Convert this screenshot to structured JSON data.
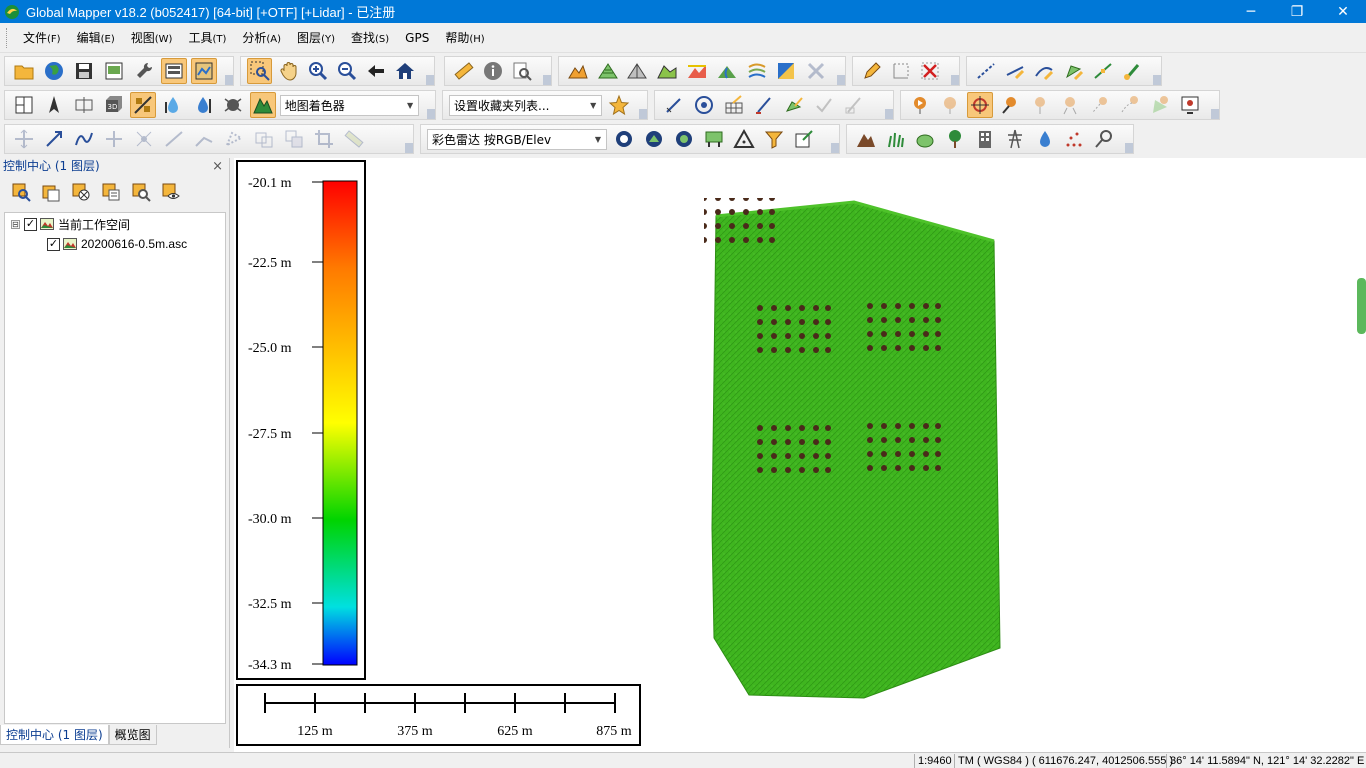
{
  "window": {
    "title": "Global Mapper v18.2 (b052417) [64-bit] [+OTF] [+Lidar] - 已注册",
    "minimize": "─",
    "restore": "❐",
    "close": "✕"
  },
  "menu": [
    {
      "label": "文件",
      "acc": "(F)"
    },
    {
      "label": "编辑",
      "acc": "(E)"
    },
    {
      "label": "视图",
      "acc": "(W)"
    },
    {
      "label": "工具",
      "acc": "(T)"
    },
    {
      "label": "分析",
      "acc": "(A)"
    },
    {
      "label": "图层",
      "acc": "(Y)"
    },
    {
      "label": "查找",
      "acc": "(S)"
    },
    {
      "label": "GPS",
      "acc": ""
    },
    {
      "label": "帮助",
      "acc": "(H)"
    }
  ],
  "toolbar": {
    "shader_select": "地图着色器",
    "favorites_select": "设置收藏夹列表...",
    "lidar_color_select": "彩色雷达 按RGB/Elev"
  },
  "control_center": {
    "title": "控制中心 (1 图层)",
    "close": "×",
    "tree": {
      "workspace_label": "当前工作空间",
      "layer_label": "20200616-0.5m.asc",
      "expander": "⊟",
      "check": "✓"
    },
    "tabs": [
      "控制中心 (1 图层)",
      "概览图"
    ]
  },
  "legend": {
    "labels": [
      "-20.1 m",
      "-22.5 m",
      "-25.0 m",
      "-27.5 m",
      "-30.0 m",
      "-32.5 m",
      "-34.3 m"
    ]
  },
  "scale_bar": {
    "labels": [
      "125 m",
      "375 m",
      "625 m",
      "875 m"
    ]
  },
  "status": {
    "scale": "1:9460",
    "projection": "TM ( WGS84 ) ( 611676.247, 4012506.555 )",
    "coords": "36° 14' 11.5894\" N, 121° 14' 32.2282\" E"
  },
  "colors": {
    "titlebar": "#0078d7",
    "terrain": "#3fb51f",
    "active_tool": "#f8c77a"
  }
}
